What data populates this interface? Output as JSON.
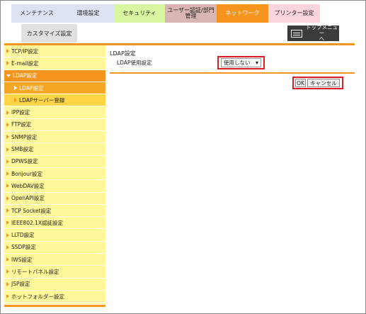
{
  "tabs": [
    {
      "label": "メンテナンス",
      "bg": "#dde3f5",
      "fg": "#222222"
    },
    {
      "label": "環境設定",
      "bg": "#dde3f5",
      "fg": "#222222"
    },
    {
      "label": "セキュリティ",
      "bg": "#d8f5a0",
      "fg": "#222222"
    },
    {
      "label": "ユーザー認証/部門\n管理",
      "bg": "#d9b6b4",
      "fg": "#222222"
    },
    {
      "label": "ネットワーク",
      "bg": "#f5951e",
      "fg": "#ffffff"
    },
    {
      "label": "プリンター設定",
      "bg": "#fcd4dc",
      "fg": "#222222"
    }
  ],
  "subtab": {
    "label": "カスタマイズ設定"
  },
  "top_menu": {
    "label": "トップメニュー\nへ",
    "icon": "menu-icon"
  },
  "sidebar": {
    "items": [
      {
        "label": "TCP/IP設定",
        "kind": "normal"
      },
      {
        "label": "E-mail設定",
        "kind": "normal"
      },
      {
        "label": "LDAP設定",
        "kind": "active"
      },
      {
        "label": "LDAP設定",
        "kind": "sub-current"
      },
      {
        "label": "LDAPサーバー登録",
        "kind": "sub"
      },
      {
        "label": "IPP設定",
        "kind": "normal"
      },
      {
        "label": "FTP設定",
        "kind": "normal"
      },
      {
        "label": "SNMP設定",
        "kind": "normal"
      },
      {
        "label": "SMB設定",
        "kind": "normal"
      },
      {
        "label": "DPWS設定",
        "kind": "normal"
      },
      {
        "label": "Bonjour設定",
        "kind": "normal"
      },
      {
        "label": "WebDAV設定",
        "kind": "normal"
      },
      {
        "label": "OpenAPI設定",
        "kind": "normal"
      },
      {
        "label": "TCP Socket設定",
        "kind": "normal"
      },
      {
        "label": "IEEE802.1X認証設定",
        "kind": "normal"
      },
      {
        "label": "LLTD設定",
        "kind": "normal"
      },
      {
        "label": "SSDP設定",
        "kind": "normal"
      },
      {
        "label": "IWS設定",
        "kind": "normal"
      },
      {
        "label": "リモートパネル設定",
        "kind": "normal"
      },
      {
        "label": "JSP設定",
        "kind": "normal"
      },
      {
        "label": "ホットフォルダー設定",
        "kind": "normal"
      }
    ]
  },
  "main": {
    "title": "LDAP設定",
    "setting_label": "LDAP使用設定",
    "select_value": "使用しない",
    "ok_label": "OK",
    "cancel_label": "キャンセル"
  },
  "colors": {
    "accent": "#f5951e",
    "sidebar_bg": "#fff799",
    "highlight": "#e01b24"
  }
}
